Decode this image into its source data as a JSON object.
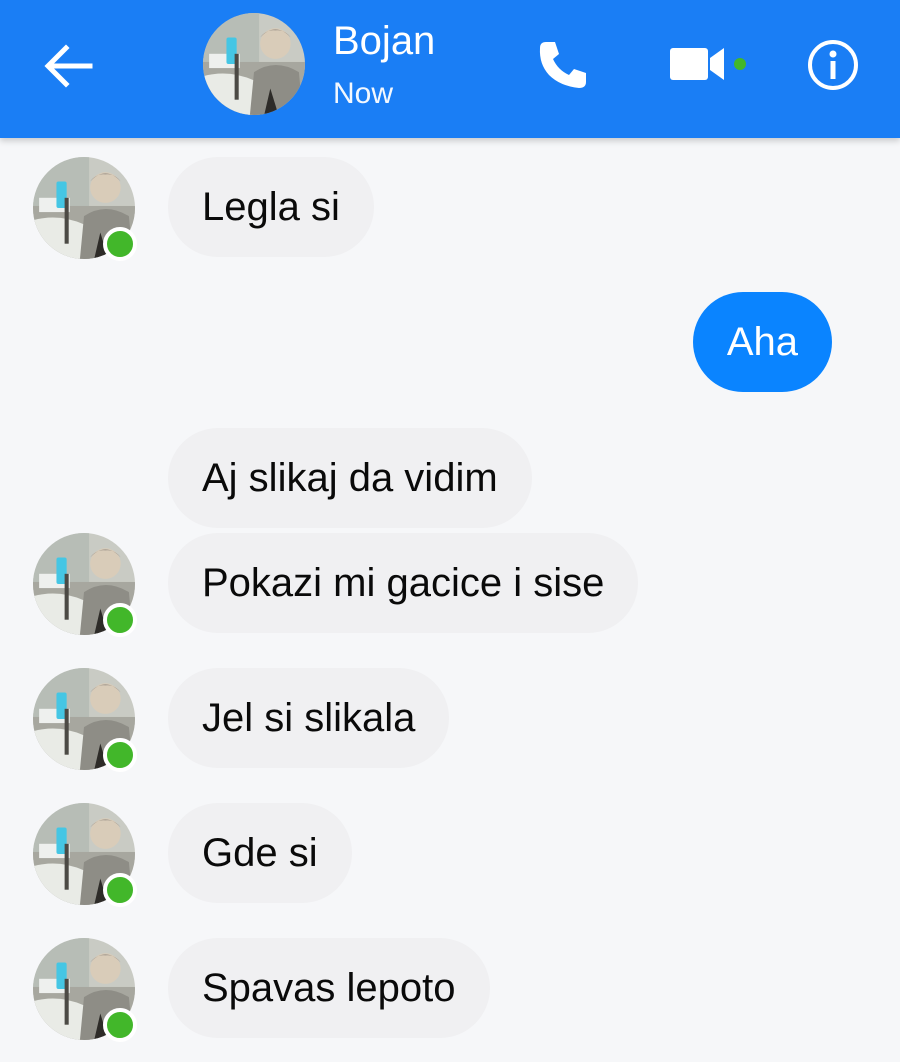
{
  "header": {
    "contact_name": "Bojan",
    "status": "Now",
    "accent_color": "#1a7ef5",
    "icons": [
      "back-arrow-icon",
      "phone-icon",
      "video-camera-icon",
      "info-icon"
    ]
  },
  "messages": [
    {
      "direction": "in",
      "text": "Legla si",
      "show_avatar": true
    },
    {
      "direction": "out",
      "text": "Aha"
    },
    {
      "direction": "in",
      "text": "Aj slikaj da vidim",
      "show_avatar": false
    },
    {
      "direction": "in",
      "text": "Pokazi mi gacice i sise",
      "show_avatar": true
    },
    {
      "direction": "in",
      "text": "Jel si slikala",
      "show_avatar": true
    },
    {
      "direction": "in",
      "text": "Gde si",
      "show_avatar": true
    },
    {
      "direction": "in",
      "text": "Spavas lepoto",
      "show_avatar": true
    }
  ],
  "colors": {
    "incoming_bubble": "#f0f0f2",
    "outgoing_bubble": "#0a84ff",
    "online_indicator": "#42b72a"
  }
}
